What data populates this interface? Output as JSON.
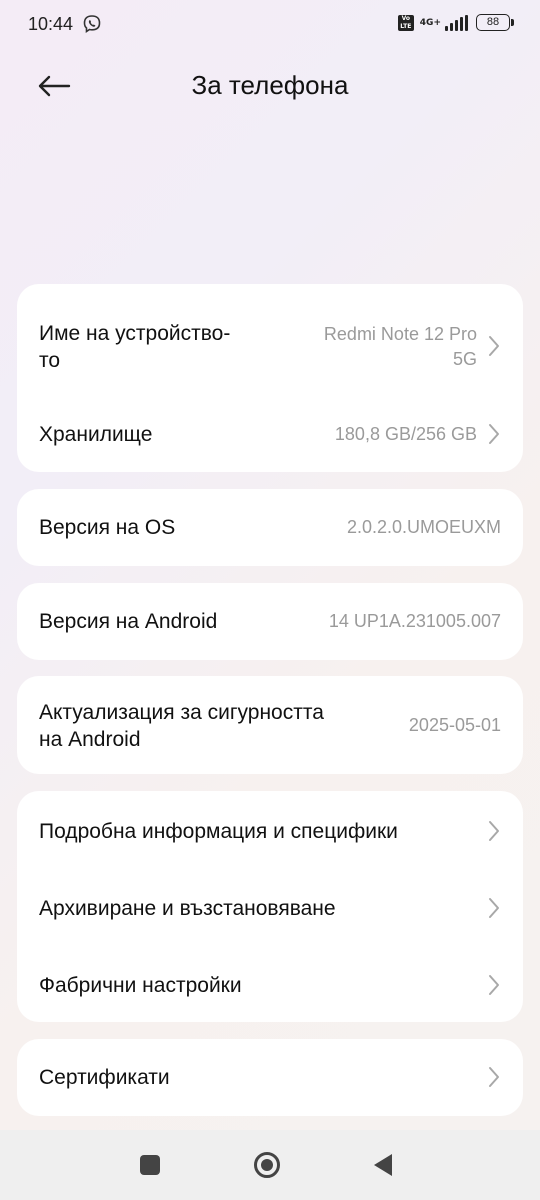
{
  "status_bar": {
    "time": "10:44",
    "volte_label": "Vo LTE",
    "network_type": "4G+",
    "battery": "88"
  },
  "header": {
    "title": "За телефона",
    "back_icon": "arrow-left-icon"
  },
  "device_card": {
    "device_name_label": "Име на устройство-\nто",
    "device_name_value": "Redmi Note 12 Pro\n5G",
    "storage_label": "Хранилище",
    "storage_value": "180,8 GB/256 GB"
  },
  "os_card": {
    "label": "Версия на OS",
    "value": "2.0.2.0.UMOEUXM"
  },
  "android_card": {
    "label": "Версия на Android",
    "value": "14 UP1A.231005.007"
  },
  "security_card": {
    "label": "Актуализация за сигурността\nна Android",
    "value": "2025-05-01"
  },
  "more_card": {
    "details_label": "Подробна информация и специфики",
    "backup_label": "Архивиране и възстановяване",
    "factory_label": "Фабрични настройки"
  },
  "certs_card": {
    "label": "Сертификати"
  },
  "nav_bar": {
    "recents_icon": "square-icon",
    "home_icon": "circle-icon",
    "back_icon": "triangle-back-icon"
  },
  "colors": {
    "card_bg": "#ffffff",
    "value_text": "#9a9a9a",
    "chevron": "#a8a8a8"
  }
}
